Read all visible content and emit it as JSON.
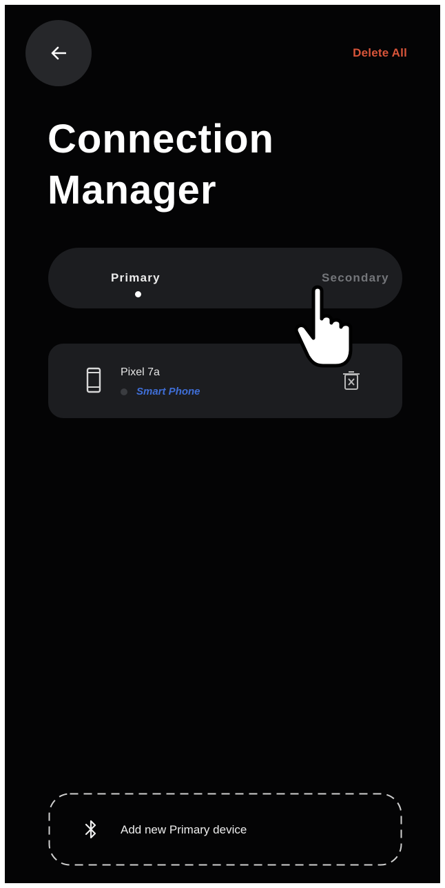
{
  "header": {
    "delete_all_label": "Delete All",
    "title_line1": "Connection",
    "title_line2": "Manager"
  },
  "tabs": [
    {
      "label": "Primary",
      "selected": true
    },
    {
      "label": "Secondary",
      "selected": false
    }
  ],
  "devices": [
    {
      "name": "Pixel 7a",
      "type": "Smart Phone",
      "icon": "phone-icon"
    }
  ],
  "add_device": {
    "label": "Add new Primary device",
    "icon": "bluetooth-icon"
  },
  "colors": {
    "background": "#040405",
    "surface": "#1c1d20",
    "accent_delete": "#d9553a",
    "device_type": "#3f6ed6"
  }
}
